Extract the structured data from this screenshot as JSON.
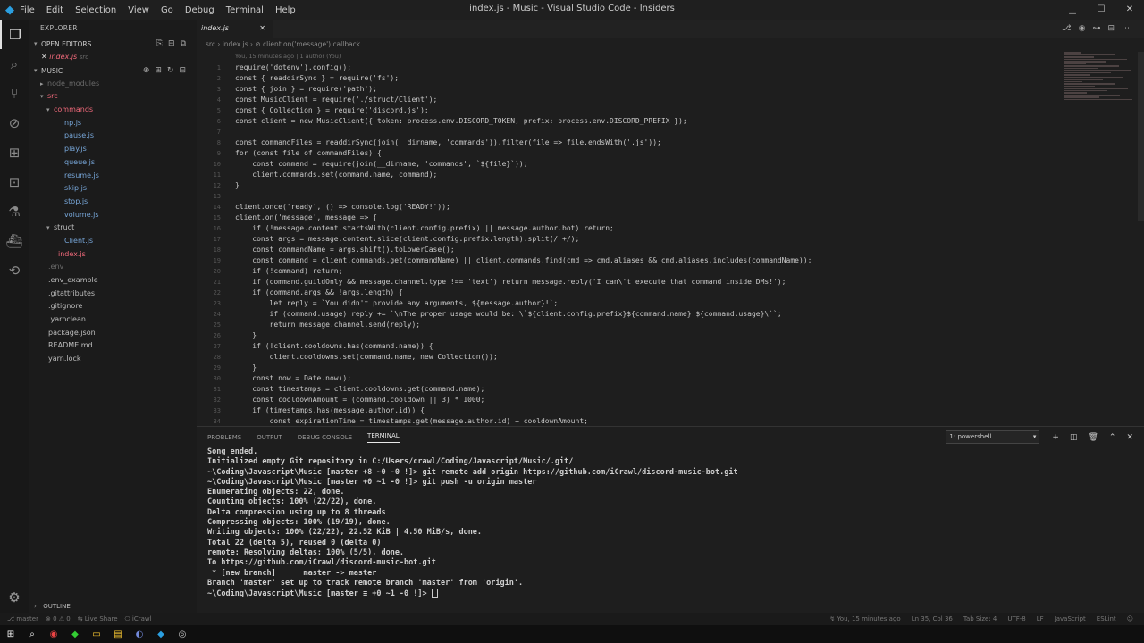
{
  "titlebar": {
    "menu": [
      "File",
      "Edit",
      "Selection",
      "View",
      "Go",
      "Debug",
      "Terminal",
      "Help"
    ],
    "title": "index.js - Music - Visual Studio Code - Insiders"
  },
  "sidebar": {
    "header": "EXPLORER",
    "open_editors_label": "OPEN EDITORS",
    "open_file_name": "index.js",
    "open_file_dir": "src",
    "project_label": "MUSIC",
    "tree": [
      {
        "name": "node_modules",
        "depth": 1,
        "kind": "folder-collapsed",
        "style": "gray"
      },
      {
        "name": "src",
        "depth": 1,
        "kind": "folder-open",
        "style": "red"
      },
      {
        "name": "commands",
        "depth": 2,
        "kind": "folder-open",
        "style": "red"
      },
      {
        "name": "np.js",
        "depth": 3,
        "kind": "file",
        "style": "blue"
      },
      {
        "name": "pause.js",
        "depth": 3,
        "kind": "file",
        "style": "blue"
      },
      {
        "name": "play.js",
        "depth": 3,
        "kind": "file",
        "style": "blue"
      },
      {
        "name": "queue.js",
        "depth": 3,
        "kind": "file",
        "style": "blue"
      },
      {
        "name": "resume.js",
        "depth": 3,
        "kind": "file",
        "style": "blue"
      },
      {
        "name": "skip.js",
        "depth": 3,
        "kind": "file",
        "style": "blue"
      },
      {
        "name": "stop.js",
        "depth": 3,
        "kind": "file",
        "style": "blue"
      },
      {
        "name": "volume.js",
        "depth": 3,
        "kind": "file",
        "style": "blue"
      },
      {
        "name": "struct",
        "depth": 2,
        "kind": "folder-open",
        "style": "norm"
      },
      {
        "name": "Client.js",
        "depth": 3,
        "kind": "file",
        "style": "blue"
      },
      {
        "name": "index.js",
        "depth": 2,
        "kind": "file",
        "style": "red"
      },
      {
        "name": ".env",
        "depth": 1,
        "kind": "file",
        "style": "gray"
      },
      {
        "name": ".env_example",
        "depth": 1,
        "kind": "file",
        "style": "norm"
      },
      {
        "name": ".gitattributes",
        "depth": 1,
        "kind": "file",
        "style": "norm"
      },
      {
        "name": ".gitignore",
        "depth": 1,
        "kind": "file",
        "style": "norm"
      },
      {
        "name": ".yarnclean",
        "depth": 1,
        "kind": "file",
        "style": "norm"
      },
      {
        "name": "package.json",
        "depth": 1,
        "kind": "file",
        "style": "norm"
      },
      {
        "name": "README.md",
        "depth": 1,
        "kind": "file",
        "style": "norm"
      },
      {
        "name": "yarn.lock",
        "depth": 1,
        "kind": "file",
        "style": "norm"
      }
    ],
    "outline_label": "OUTLINE"
  },
  "editor": {
    "tab_label": "index.js",
    "breadcrumb": "src › index.js › ⊘ client.on('message') callback",
    "blame": "You, 15 minutes ago | 1 author (You)",
    "lines": [
      "require('dotenv').config();",
      "const { readdirSync } = require('fs');",
      "const { join } = require('path');",
      "const MusicClient = require('./struct/Client');",
      "const { Collection } = require('discord.js');",
      "const client = new MusicClient({ token: process.env.DISCORD_TOKEN, prefix: process.env.DISCORD_PREFIX });",
      "",
      "const commandFiles = readdirSync(join(__dirname, 'commands')).filter(file => file.endsWith('.js'));",
      "for (const file of commandFiles) {",
      "    const command = require(join(__dirname, 'commands', `${file}`));",
      "    client.commands.set(command.name, command);",
      "}",
      "",
      "client.once('ready', () => console.log('READY!'));",
      "client.on('message', message => {",
      "    if (!message.content.startsWith(client.config.prefix) || message.author.bot) return;",
      "    const args = message.content.slice(client.config.prefix.length).split(/ +/);",
      "    const commandName = args.shift().toLowerCase();",
      "    const command = client.commands.get(commandName) || client.commands.find(cmd => cmd.aliases && cmd.aliases.includes(commandName));",
      "    if (!command) return;",
      "    if (command.guildOnly && message.channel.type !== 'text') return message.reply('I can\\'t execute that command inside DMs!');",
      "    if (command.args && !args.length) {",
      "        let reply = `You didn't provide any arguments, ${message.author}!`;",
      "        if (command.usage) reply += `\\nThe proper usage would be: \\`${client.config.prefix}${command.name} ${command.usage}\\``;",
      "        return message.channel.send(reply);",
      "    }",
      "    if (!client.cooldowns.has(command.name)) {",
      "        client.cooldowns.set(command.name, new Collection());",
      "    }",
      "    const now = Date.now();",
      "    const timestamps = client.cooldowns.get(command.name);",
      "    const cooldownAmount = (command.cooldown || 3) * 1000;",
      "    if (timestamps.has(message.author.id)) {",
      "        const expirationTime = timestamps.get(message.author.id) + cooldownAmount;"
    ]
  },
  "panel": {
    "tabs": [
      "PROBLEMS",
      "OUTPUT",
      "DEBUG CONSOLE",
      "TERMINAL"
    ],
    "active_tab": "TERMINAL",
    "terminal_select": "1: powershell",
    "terminal_lines": [
      "Song ended.",
      "Initialized empty Git repository in C:/Users/crawl/Coding/Javascript/Music/.git/",
      "~\\Coding\\Javascript\\Music [master +8 ~0 -0 !]> git remote add origin https://github.com/iCrawl/discord-music-bot.git",
      "~\\Coding\\Javascript\\Music [master +0 ~1 -0 !]> git push -u origin master",
      "Enumerating objects: 22, done.",
      "Counting objects: 100% (22/22), done.",
      "Delta compression using up to 8 threads",
      "Compressing objects: 100% (19/19), done.",
      "Writing objects: 100% (22/22), 22.52 KiB | 4.50 MiB/s, done.",
      "Total 22 (delta 5), reused 0 (delta 0)",
      "remote: Resolving deltas: 100% (5/5), done.",
      "To https://github.com/iCrawl/discord-music-bot.git",
      " * [new branch]      master -> master",
      "Branch 'master' set up to track remote branch 'master' from 'origin'.",
      "~\\Coding\\Javascript\\Music [master ≡ +0 ~1 -0 !]> "
    ]
  },
  "statusbar": {
    "left": [
      "⎇ master",
      "⊗ 0 ⚠ 0",
      "⇆ Live Share",
      "⎔ iCrawl"
    ],
    "right": [
      "↯ You, 15 minutes ago",
      "Ln 35, Col 36",
      "Tab Size: 4",
      "UTF-8",
      "LF",
      "JavaScript",
      "ESLint",
      "☺"
    ]
  }
}
